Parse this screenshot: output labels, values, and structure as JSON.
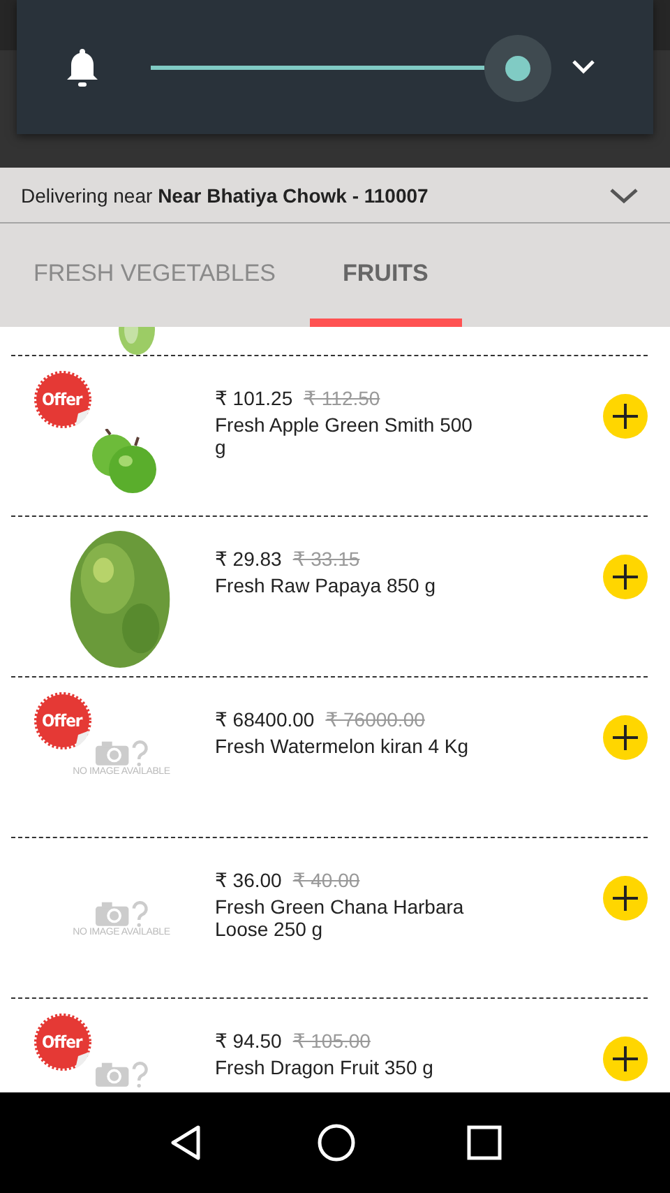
{
  "volume_panel": {
    "level": 1.0
  },
  "location_bar": {
    "text": "Delivering near **Near Bhatiya Chowk - 110007**"
  },
  "tabs": [
    {
      "label": "FRESH VEGETABLES",
      "selected": false
    },
    {
      "label": "FRUITS",
      "selected": true
    }
  ],
  "products": [
    {
      "offer": true,
      "badge": "Offer",
      "price": "₹ 101.25",
      "old_price": "₹ 112.50",
      "name": "Fresh Apple Green Smith 500 g"
    },
    {
      "offer": false,
      "price": "₹ 29.83",
      "old_price": "₹ 33.15",
      "name": "Fresh Raw Papaya 850 g"
    },
    {
      "kind": "no_image",
      "offer": true,
      "badge": "Offer",
      "no_image_text": "NO IMAGE AVAILABLE",
      "price": "₹ 68400.00",
      "old_price": "₹ 76000.00",
      "name": "Fresh Watermelon kiran 4 Kg"
    },
    {
      "kind": "no_image",
      "offer": false,
      "no_image_text": "NO IMAGE AVAILABLE",
      "price": "₹ 36.00",
      "old_price": "₹ 40.00",
      "name": "Fresh Green Chana Harbara Loose 250 g"
    },
    {
      "kind": "no_image",
      "offer": true,
      "badge": "Offer",
      "price": "₹ 94.50",
      "old_price": "₹ 105.00",
      "name": "Fresh Dragon Fruit 350 g"
    }
  ]
}
